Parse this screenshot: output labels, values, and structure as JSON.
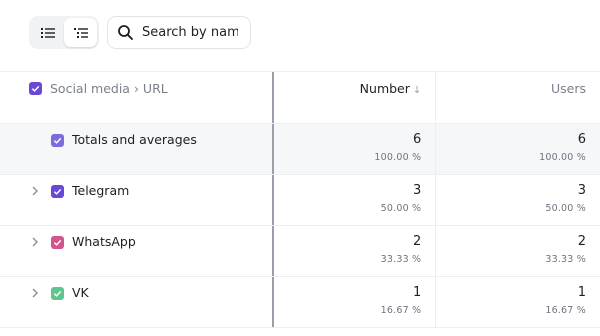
{
  "toolbar": {
    "view_toggle": [
      {
        "icon": "list-icon",
        "active": false
      },
      {
        "icon": "tree-list-icon",
        "active": true
      }
    ],
    "search": {
      "placeholder": "Search by name",
      "icon": "search-icon"
    }
  },
  "table": {
    "header": {
      "grouping_label": "Social media › URL",
      "number_label": "Number",
      "number_sort": "↓",
      "users_label": "Users"
    },
    "rows": [
      {
        "label": "Totals and averages",
        "color": "#7b6cdb",
        "expandable": false,
        "number": "6",
        "number_pct": "100.00 %",
        "users": "6",
        "users_pct": "100.00 %"
      },
      {
        "label": "Telegram",
        "color": "#6a47d6",
        "expandable": true,
        "number": "3",
        "number_pct": "50.00 %",
        "users": "3",
        "users_pct": "50.00 %"
      },
      {
        "label": "WhatsApp",
        "color": "#d2558f",
        "expandable": true,
        "number": "2",
        "number_pct": "33.33 %",
        "users": "2",
        "users_pct": "33.33 %"
      },
      {
        "label": "VK",
        "color": "#5fc48e",
        "expandable": true,
        "number": "1",
        "number_pct": "16.67 %",
        "users": "1",
        "users_pct": "16.67 %"
      }
    ]
  },
  "colors": {
    "header_checkbox": "#6a47d6"
  }
}
